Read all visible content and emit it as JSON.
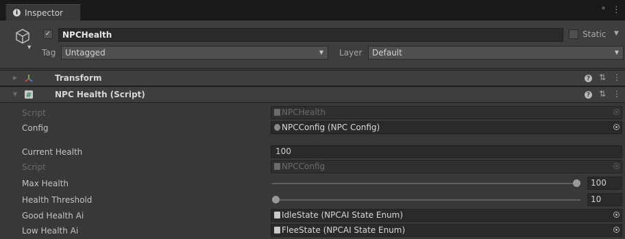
{
  "window": {
    "tab_title": "Inspector",
    "tab_icon": "info-icon",
    "lock_icon": "lock-icon",
    "menu_icon": "kebab-menu-icon"
  },
  "gameobject": {
    "name": "NPCHealth",
    "active": true,
    "static_label": "Static",
    "static_checked": false,
    "tag_label": "Tag",
    "tag_value": "Untagged",
    "layer_label": "Layer",
    "layer_value": "Default"
  },
  "components": [
    {
      "name": "Transform",
      "expanded": false,
      "icon": "transform-icon"
    },
    {
      "name": "NPC Health (Script)",
      "expanded": true,
      "icon": "script-icon"
    }
  ],
  "properties": {
    "script": {
      "label": "Script",
      "value": "NPCHealth",
      "disabled": true
    },
    "config": {
      "label": "Config",
      "value": "NPCConfig (NPC Config)"
    },
    "current_health": {
      "label": "Current Health",
      "value": "100"
    },
    "config_script": {
      "label": "Script",
      "value": "NPCConfig",
      "disabled": true
    },
    "max_health": {
      "label": "Max Health",
      "value": "100",
      "fraction": 1.0
    },
    "health_threshold": {
      "label": "Health Threshold",
      "value": "10",
      "fraction": 0.0
    },
    "good_health_ai": {
      "label": "Good Health Ai",
      "value": "IdleState (NPCAI State Enum)"
    },
    "low_health_ai": {
      "label": "Low Health Ai",
      "value": "FleeState (NPCAI State Enum)"
    }
  },
  "colors": {
    "background": "#383838",
    "header": "#3e3e3e",
    "field": "#2a2a2a",
    "text": "#c4c4c4",
    "transform_icon": "#e2a040"
  }
}
